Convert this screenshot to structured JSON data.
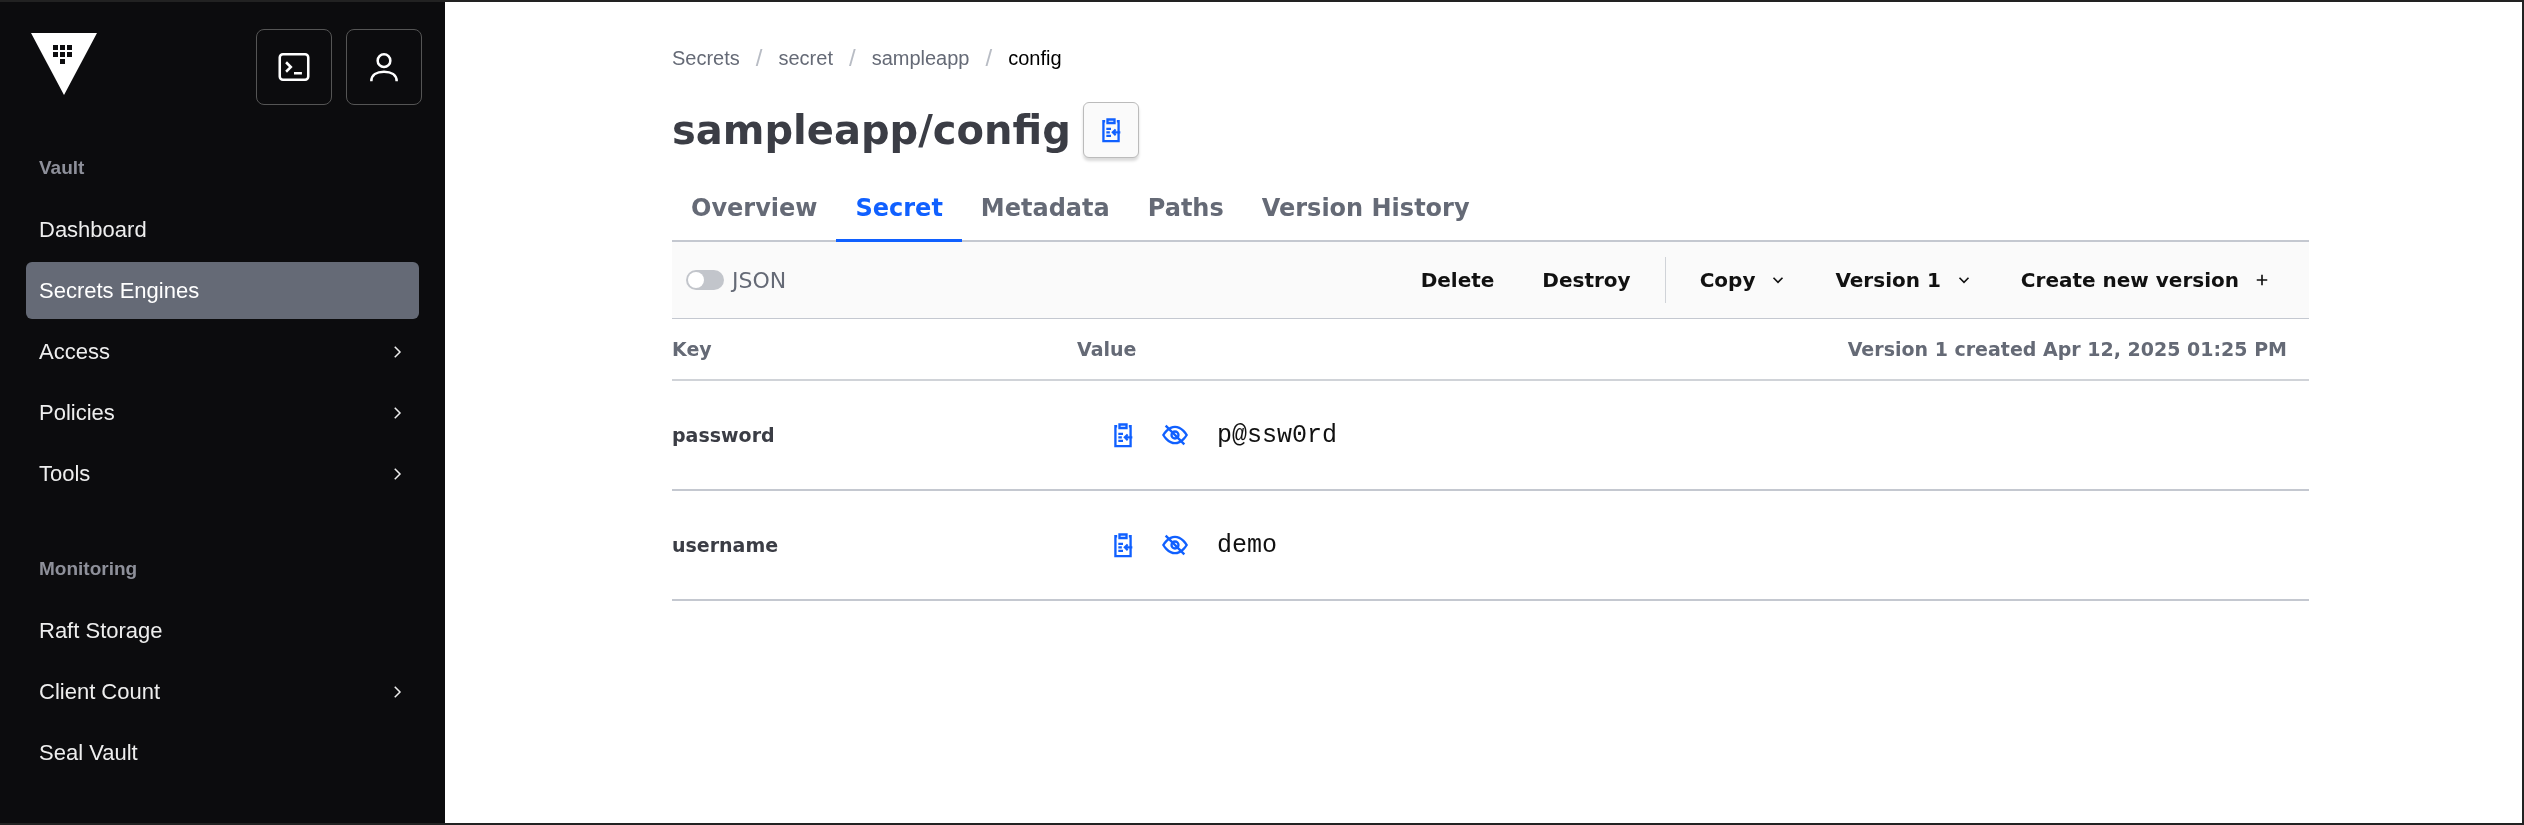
{
  "sidebar": {
    "sections": [
      {
        "heading": "Vault",
        "items": [
          {
            "label": "Dashboard",
            "selected": false,
            "has_submenu": false
          },
          {
            "label": "Secrets Engines",
            "selected": true,
            "has_submenu": false
          },
          {
            "label": "Access",
            "selected": false,
            "has_submenu": true
          },
          {
            "label": "Policies",
            "selected": false,
            "has_submenu": true
          },
          {
            "label": "Tools",
            "selected": false,
            "has_submenu": true
          }
        ]
      },
      {
        "heading": "Monitoring",
        "items": [
          {
            "label": "Raft Storage",
            "selected": false,
            "has_submenu": false
          },
          {
            "label": "Client Count",
            "selected": false,
            "has_submenu": true
          },
          {
            "label": "Seal Vault",
            "selected": false,
            "has_submenu": false
          }
        ]
      }
    ]
  },
  "breadcrumbs": [
    {
      "label": "Secrets",
      "current": false
    },
    {
      "label": "secret",
      "current": false
    },
    {
      "label": "sampleapp",
      "current": false
    },
    {
      "label": "config",
      "current": true
    }
  ],
  "breadcrumb_separator": "/",
  "title": "sampleapp/config",
  "tabs": [
    {
      "label": "Overview",
      "selected": false
    },
    {
      "label": "Secret",
      "selected": true
    },
    {
      "label": "Metadata",
      "selected": false
    },
    {
      "label": "Paths",
      "selected": false
    },
    {
      "label": "Version History",
      "selected": false
    }
  ],
  "toolbar": {
    "json_toggle": {
      "label": "JSON",
      "on": false
    },
    "actions": [
      {
        "label": "Delete",
        "kind": "plain"
      },
      {
        "label": "Destroy",
        "kind": "plain"
      },
      {
        "label": "Copy",
        "kind": "dropdown"
      },
      {
        "label": "Version 1",
        "kind": "dropdown"
      },
      {
        "label": "Create new version",
        "kind": "add"
      }
    ]
  },
  "table": {
    "columns": [
      "Key",
      "Value"
    ],
    "version_info": "Version 1 created Apr 12, 2025 01:25 PM",
    "rows": [
      {
        "key": "password",
        "value": "p@ssw0rd"
      },
      {
        "key": "username",
        "value": "demo"
      }
    ]
  }
}
